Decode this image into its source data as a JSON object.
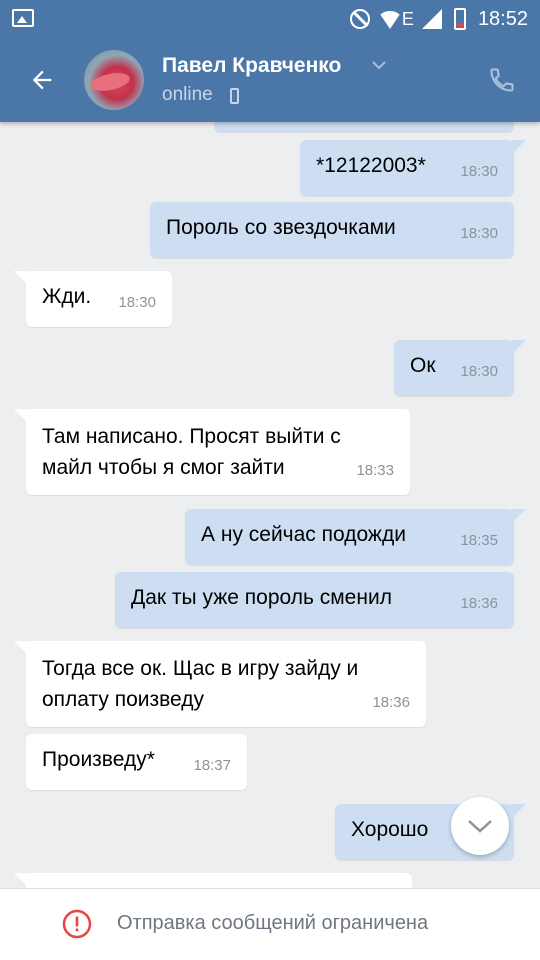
{
  "status_bar": {
    "network_label": "E",
    "time": "18:52",
    "battery_fill_fraction": 0.15
  },
  "header": {
    "contact_name": "Павел Кравченко",
    "contact_status": "online"
  },
  "messages": [
    {
      "direction": "out",
      "text": "*12122003*",
      "time": "18:30"
    },
    {
      "direction": "out",
      "text": "Пороль со звездочками",
      "time": "18:30"
    },
    {
      "direction": "in",
      "text": "Жди.",
      "time": "18:30"
    },
    {
      "direction": "out",
      "text": "Ок",
      "time": "18:30"
    },
    {
      "direction": "in",
      "text": "Там написано. Просят выйти с майл чтобы я смог зайти",
      "time": "18:33"
    },
    {
      "direction": "out",
      "text": "А ну сейчас подожди",
      "time": "18:35"
    },
    {
      "direction": "out",
      "text": "Дак ты уже пороль сменил",
      "time": "18:36"
    },
    {
      "direction": "in",
      "text": "Тогда все ок. Щас в игру зайду и оплату поизведу",
      "time": "18:36"
    },
    {
      "direction": "in",
      "text": "Произведу*",
      "time": "18:37"
    },
    {
      "direction": "out",
      "text": "Хорошо",
      "time": ""
    }
  ],
  "footer": {
    "restriction_text": "Отправка сообщений ограничена"
  },
  "colors": {
    "header_bg": "#4a76a8",
    "outgoing_bubble": "#cddef3",
    "incoming_bubble": "#ffffff",
    "chat_bg": "#edeef0",
    "warning_red": "#e64646"
  },
  "icons": [
    "image-icon",
    "dnd-icon",
    "wifi-icon",
    "signal-icon",
    "battery-icon",
    "back-arrow-icon",
    "chevron-down-icon",
    "mobile-phone-icon",
    "call-icon",
    "scroll-down-icon",
    "warning-icon"
  ]
}
